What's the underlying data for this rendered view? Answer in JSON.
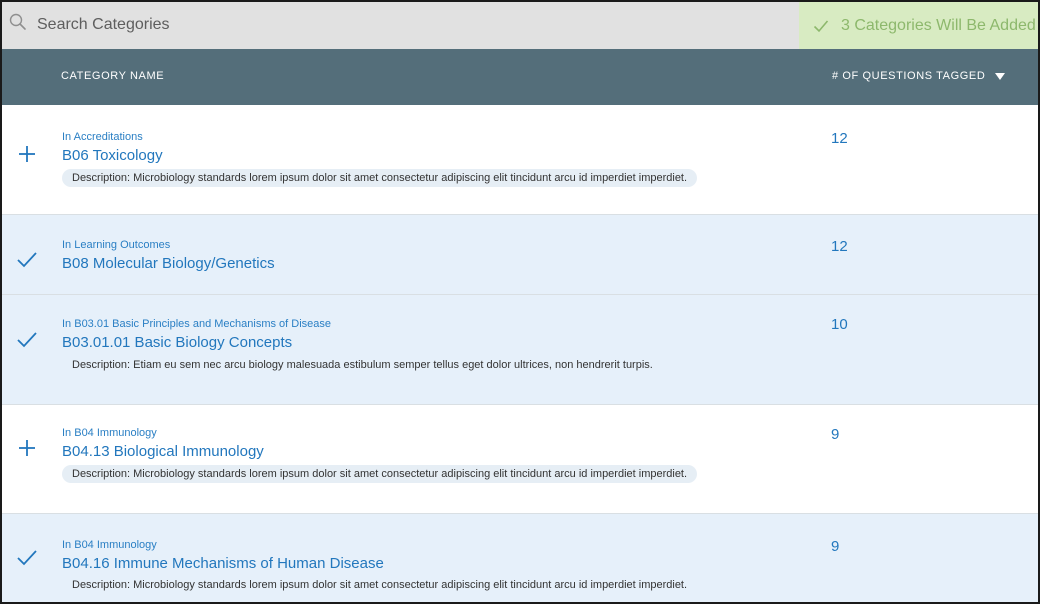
{
  "search": {
    "placeholder": "Search Categories",
    "value": ""
  },
  "banner": {
    "text": "3 Categories Will Be Added",
    "color": "#8db86c"
  },
  "header": {
    "category_name": "CATEGORY NAME",
    "questions_tagged": "# OF QUESTIONS TAGGED",
    "sort": "descending"
  },
  "rows": [
    {
      "action_icon": "plus-icon",
      "selected": false,
      "parent": "In Accreditations",
      "title": "B06 Toxicology",
      "description": "Description: Microbiology standards lorem ipsum dolor sit amet consectetur adipiscing elit tincidunt arcu id imperdiet imperdiet.",
      "count": "12"
    },
    {
      "action_icon": "check-icon",
      "selected": true,
      "parent": "In Learning Outcomes",
      "title": "B08 Molecular Biology/Genetics",
      "description": "",
      "count": "12"
    },
    {
      "action_icon": "check-icon",
      "selected": true,
      "parent": "In B03.01 Basic Principles and Mechanisms of Disease",
      "title": "B03.01.01 Basic Biology Concepts",
      "description": "Description: Etiam eu sem nec arcu biology malesuada estibulum semper tellus eget dolor ultrices, non hendrerit turpis.",
      "count": "10"
    },
    {
      "action_icon": "plus-icon",
      "selected": false,
      "parent": "In B04 Immunology",
      "title": "B04.13  Biological Immunology",
      "description": "Description: Microbiology standards lorem ipsum dolor sit amet consectetur adipiscing elit tincidunt arcu id imperdiet imperdiet.",
      "count": "9"
    },
    {
      "action_icon": "check-icon",
      "selected": true,
      "parent": "In B04 Immunology",
      "title": "B04.16 Immune Mechanisms of Human Disease",
      "description": "Description: Microbiology standards lorem ipsum dolor sit amet consectetur adipiscing elit tincidunt arcu id imperdiet imperdiet.",
      "count": "9"
    }
  ]
}
